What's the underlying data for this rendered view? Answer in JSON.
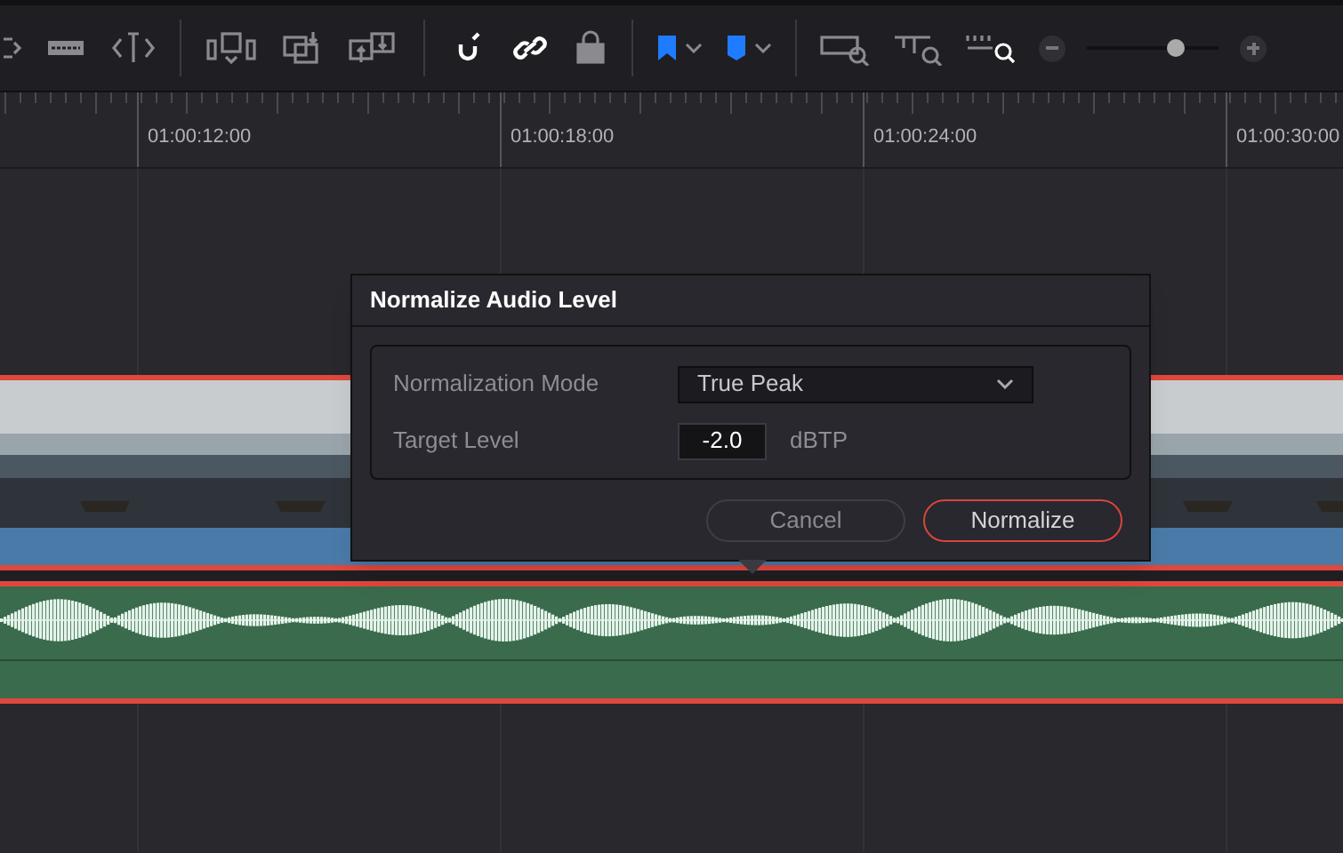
{
  "toolbar": {
    "zoom_slider": {
      "level": 0.68
    }
  },
  "ruler": {
    "timecodes": [
      "01:00:12:00",
      "01:00:18:00",
      "01:00:24:00",
      "01:00:30:00"
    ]
  },
  "dialog": {
    "title": "Normalize Audio Level",
    "fields": [
      {
        "kind": "select",
        "label": "Normalization Mode",
        "value": "True Peak"
      },
      {
        "kind": "number",
        "label": "Target Level",
        "value": "-2.0",
        "unit": "dBTP"
      }
    ],
    "buttons": [
      {
        "label": "Cancel",
        "primary": false
      },
      {
        "label": "Normalize",
        "primary": true
      }
    ]
  }
}
